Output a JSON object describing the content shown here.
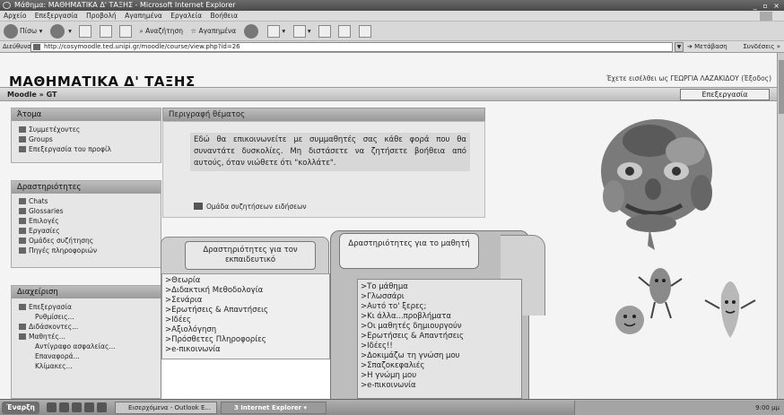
{
  "window": {
    "title": "Μάθημα: ΜΑΘΗΜΑΤΙΚΑ Δ' ΤΑΞΗΣ - Microsoft Internet Explorer",
    "controls": "_ ▫ ×"
  },
  "menu": [
    "Αρχείο",
    "Επεξεργασία",
    "Προβολή",
    "Αγαπημένα",
    "Εργαλεία",
    "Βοήθεια"
  ],
  "toolbar": {
    "back": "Πίσω",
    "search": "Αναζήτηση",
    "favorites": "Αγαπημένα"
  },
  "address": {
    "label": "Διεύθυνση",
    "url": "http://cosymoodle.ted.unipi.gr/moodle/course/view.php?id=26",
    "go": "Μετάβαση",
    "links": "Συνδέσεις »"
  },
  "page": {
    "title": "ΜΑΘΗΜΑΤΙΚΑ Δ' ΤΑΞΗΣ",
    "login_info": "Έχετε εισέλθει ως ΓΕΩΡΓΙΑ ΛΑΖΑΚΙΔΟΥ (Έξοδος)",
    "breadcrumb": "Moodle » GT",
    "edit_button": "Επεξεργασία"
  },
  "blocks": {
    "people": {
      "title": "Άτομα",
      "items": [
        "Συμμετέχοντες",
        "Groups",
        "Επεξεργασία του προφίλ"
      ]
    },
    "activities": {
      "title": "Δραστηριότητες",
      "items": [
        "Chats",
        "Glossaries",
        "Επιλογές",
        "Εργασίες",
        "Ομάδες συζήτησης",
        "Πηγές πληροφοριών"
      ]
    },
    "admin": {
      "title": "Διαχείριση",
      "items": [
        "Επεξεργασία",
        "Ρυθμίσεις...",
        "Διδάσκοντες...",
        "Μαθητές...",
        "Αντίγραφο ασφαλείας...",
        "Επαναφορά...",
        "Κλίμακες..."
      ]
    }
  },
  "description": {
    "title": "Περιγραφή θέματος",
    "text": "Εδώ θα επικοινωνείτε με συμμαθητές σας κάθε φορά που θα συναντάτε δυσκολίες. Μη διστάσετε να ζητήσετε βοήθεια από αυτούς, όταν νιώθετε ότι \"κολλάτε\".",
    "forum_link": "Ομάδα συζητήσεων ειδήσεων"
  },
  "teacher_folder": {
    "title": "Δραστηριότητες για τον εκπαιδευτικό",
    "items": [
      "Θεωρία",
      "Διδακτική Μεθοδολογία",
      "Σενάρια",
      "Ερωτήσεις & Απαντήσεις",
      "Ιδέες",
      "Αξιολόγηση",
      "Πρόσθετες Πληροφορίες",
      "e-πικοινωνία"
    ]
  },
  "student_folder": {
    "title": "Δραστηριότητες για το μαθητή",
    "items": [
      "Το μάθημα",
      "Γλωσσάρι",
      "Αυτό το' ξερες;",
      "Κι άλλα...προβλήματα",
      "Οι μαθητές δημιουργούν",
      "Ερωτήσεις & Απαντήσεις",
      "Ιδέες!!",
      "Δοκιμάζω τη γνώση μου",
      "Σπαζοκεφαλιές",
      "Η γνώμη μου",
      "e-πικοινωνία"
    ]
  },
  "taskbar": {
    "start": "Έναρξη",
    "tasks": [
      "Εισερχόμενα - Outlook E...",
      "3 Internet Explorer"
    ],
    "clock": "9:00 μμ"
  }
}
